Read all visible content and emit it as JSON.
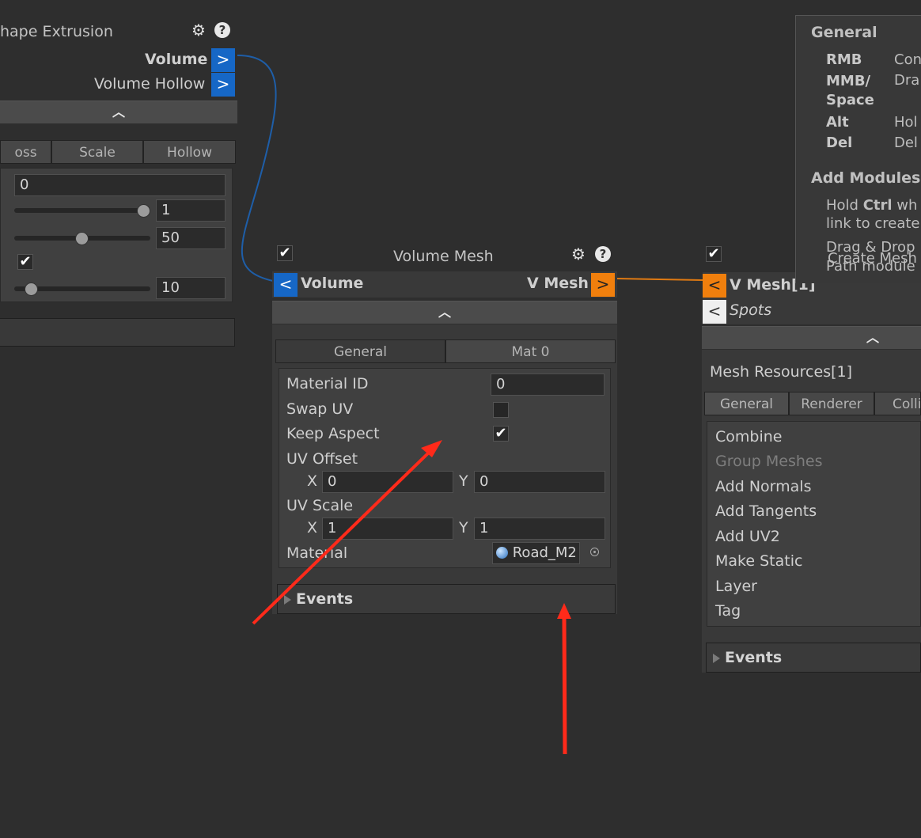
{
  "left_node": {
    "title": "hape Extrusion",
    "ports": [
      "Volume",
      "Volume Hollow"
    ],
    "port_symbol": ">",
    "tabs": [
      "oss",
      "Scale",
      "Hollow"
    ],
    "fields": [
      "0",
      "1",
      "50",
      "10"
    ],
    "sliders": [
      0.98,
      0.5,
      0.12
    ]
  },
  "volume_mesh": {
    "title": "Volume Mesh",
    "input_port": "Volume",
    "input_symbol": "<",
    "output_port": "V Mesh",
    "output_symbol": ">",
    "tabs": [
      "General",
      "Mat 0"
    ],
    "material_id_label": "Material ID",
    "material_id": "0",
    "swap_uv_label": "Swap UV",
    "swap_uv": false,
    "keep_aspect_label": "Keep Aspect",
    "keep_aspect": true,
    "uv_offset_label": "UV Offset",
    "uv_offset": {
      "x_label": "X",
      "x": "0",
      "y_label": "Y",
      "y": "0"
    },
    "uv_scale_label": "UV Scale",
    "uv_scale": {
      "x_label": "X",
      "x": "1",
      "y_label": "Y",
      "y": "1"
    },
    "material_label": "Material",
    "material": "Road_M2",
    "events": "Events"
  },
  "right_node": {
    "input_port": "V Mesh[1]",
    "input_symbol": "<",
    "spots_port": "Spots",
    "spots_symbol": "<",
    "section_title": "Mesh Resources[1]",
    "tabs": [
      "General",
      "Renderer",
      "Colli"
    ],
    "items": [
      "Combine",
      "Group Meshes",
      "Add Normals",
      "Add Tangents",
      "Add UV2",
      "Make Static",
      "Layer",
      "Tag"
    ],
    "events": "Events"
  },
  "help_panel": {
    "general_title": "General",
    "shortcuts": [
      {
        "key": "RMB",
        "desc": "Con"
      },
      {
        "key": "MMB/\nSpace",
        "desc": "Dra"
      },
      {
        "key": "Alt",
        "desc": "Hol"
      },
      {
        "key": "Del",
        "desc": "Del"
      }
    ],
    "add_modules_title": "Add Modules",
    "hold_prefix": "Hold ",
    "hold_key": "Ctrl",
    "hold_suffix": " wh",
    "line2": "link to create",
    "line3": "Drag & Drop",
    "line3b": "Create Mesh",
    "line4": "Path module"
  },
  "colors": {
    "blue_port": "#1667c6",
    "orange_port": "#f07f0d",
    "arrow": "#ff2a1a"
  },
  "icons": [
    "gear-icon",
    "help-icon",
    "checkbox-icon",
    "chevron-up-icon",
    "triangle-right-icon",
    "material-sphere-icon",
    "object-picker-icon"
  ]
}
